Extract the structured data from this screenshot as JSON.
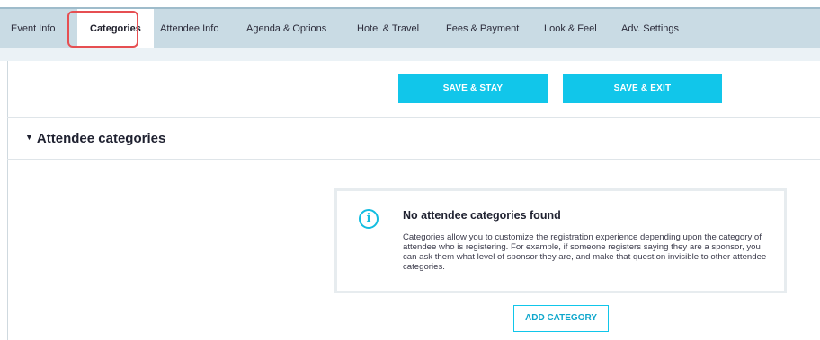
{
  "tabs": [
    {
      "label": "Event Info"
    },
    {
      "label": "Categories",
      "active": true
    },
    {
      "label": "Attendee Info"
    },
    {
      "label": "Agenda & Options"
    },
    {
      "label": "Hotel & Travel"
    },
    {
      "label": "Fees & Payment"
    },
    {
      "label": "Look & Feel"
    },
    {
      "label": "Adv. Settings"
    }
  ],
  "actions": {
    "save_stay": "SAVE & STAY",
    "save_exit": "SAVE & EXIT"
  },
  "section": {
    "title": "Attendee categories",
    "caret_icon": "caret-down-icon"
  },
  "empty_state": {
    "icon": "info-icon",
    "icon_glyph": "i",
    "title": "No attendee categories found",
    "body": "Categories allow you to customize the registration experience depending upon the category of attendee who is registering. For example, if someone registers saying they are a sponsor, you can ask them what level of sponsor they are, and make that question invisible to other attendee categories."
  },
  "add_button": "ADD CATEGORY",
  "colors": {
    "accent": "#11c6ea",
    "tabbar": "#c9dbe4",
    "highlight": "#e64f52"
  }
}
